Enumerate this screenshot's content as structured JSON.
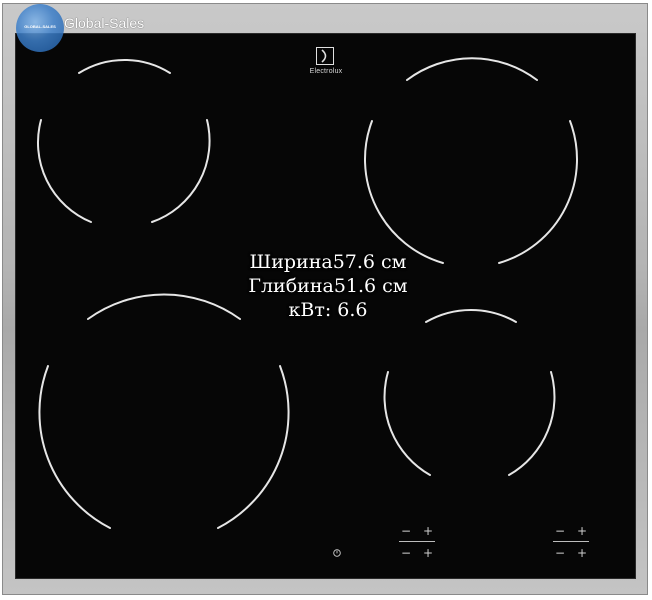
{
  "watermark": {
    "globe_text": "GLOBAL-SALES",
    "label": "Global-Sales"
  },
  "brand": {
    "name": "Electrolux",
    "logo_icon": "electrolux-logo-icon"
  },
  "specs": {
    "width": "Ширина57.6 см",
    "depth": "Глибина51.6 см",
    "power": "кВт: 6.6"
  },
  "controls": {
    "minus": "−",
    "plus": "+",
    "power_icon": "power-icon"
  },
  "colors": {
    "glass": "#060606",
    "frame": "#b8b8b8",
    "burner_outline": "#e6e6e6"
  }
}
